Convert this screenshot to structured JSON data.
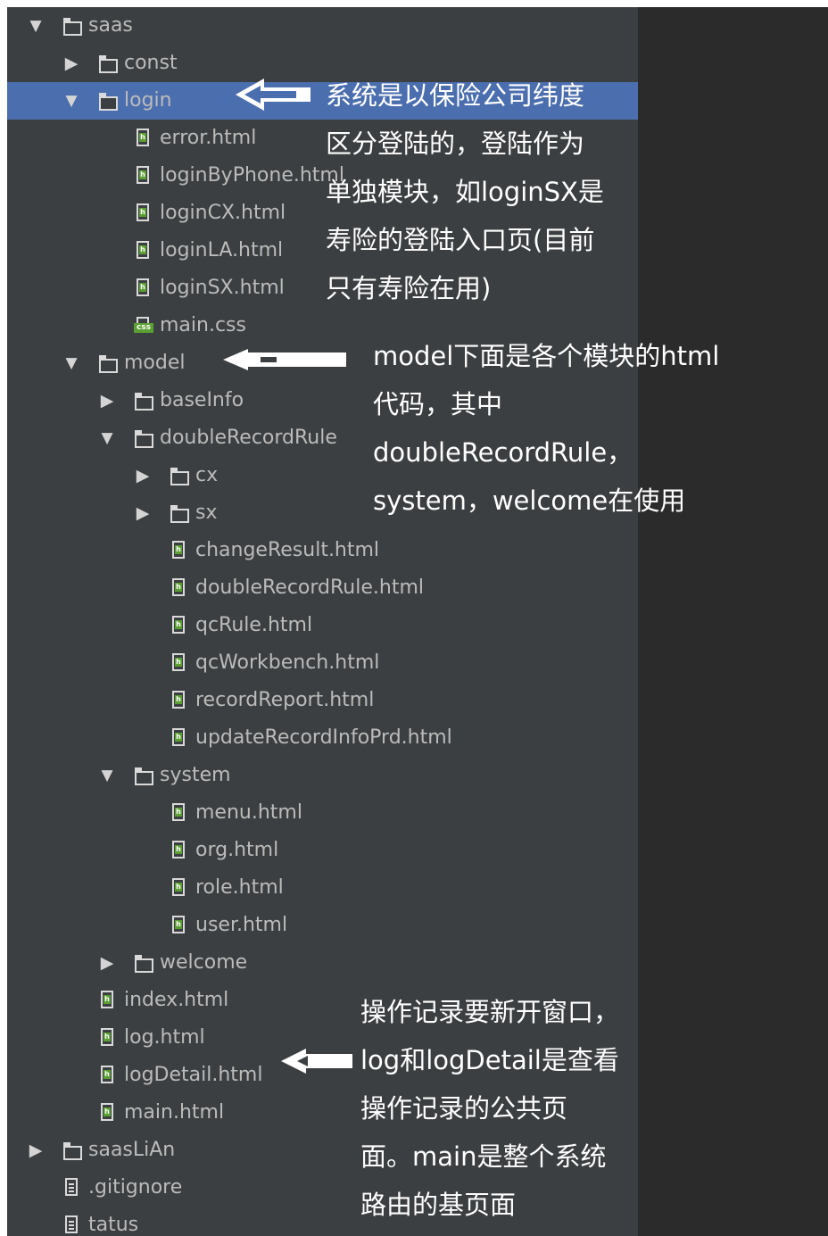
{
  "tree": [
    {
      "label": "saas",
      "type": "folder",
      "depth": 0,
      "arrow": "down"
    },
    {
      "label": "const",
      "type": "folder",
      "depth": 1,
      "arrow": "right"
    },
    {
      "label": "login",
      "type": "folder",
      "depth": 1,
      "arrow": "down",
      "selected": true
    },
    {
      "label": "error.html",
      "type": "html",
      "depth": 2
    },
    {
      "label": "loginByPhone.html",
      "type": "html",
      "depth": 2
    },
    {
      "label": "loginCX.html",
      "type": "html",
      "depth": 2
    },
    {
      "label": "loginLA.html",
      "type": "html",
      "depth": 2
    },
    {
      "label": "loginSX.html",
      "type": "html",
      "depth": 2
    },
    {
      "label": "main.css",
      "type": "css",
      "depth": 2
    },
    {
      "label": "model",
      "type": "folder",
      "depth": 1,
      "arrow": "down"
    },
    {
      "label": "baseInfo",
      "type": "folder",
      "depth": 2,
      "arrow": "right"
    },
    {
      "label": "doubleRecordRule",
      "type": "folder",
      "depth": 2,
      "arrow": "down"
    },
    {
      "label": "cx",
      "type": "folder",
      "depth": 3,
      "arrow": "right"
    },
    {
      "label": "sx",
      "type": "folder",
      "depth": 3,
      "arrow": "right"
    },
    {
      "label": "changeResult.html",
      "type": "html",
      "depth": 3
    },
    {
      "label": "doubleRecordRule.html",
      "type": "html",
      "depth": 3
    },
    {
      "label": "qcRule.html",
      "type": "html",
      "depth": 3
    },
    {
      "label": "qcWorkbench.html",
      "type": "html",
      "depth": 3
    },
    {
      "label": "recordReport.html",
      "type": "html",
      "depth": 3
    },
    {
      "label": "updateRecordInfoPrd.html",
      "type": "html",
      "depth": 3
    },
    {
      "label": "system",
      "type": "folder",
      "depth": 2,
      "arrow": "down"
    },
    {
      "label": "menu.html",
      "type": "html",
      "depth": 3
    },
    {
      "label": "org.html",
      "type": "html",
      "depth": 3
    },
    {
      "label": "role.html",
      "type": "html",
      "depth": 3
    },
    {
      "label": "user.html",
      "type": "html",
      "depth": 3
    },
    {
      "label": "welcome",
      "type": "folder",
      "depth": 2,
      "arrow": "right"
    },
    {
      "label": "index.html",
      "type": "html",
      "depth": 1
    },
    {
      "label": "log.html",
      "type": "html",
      "depth": 1
    },
    {
      "label": "logDetail.html",
      "type": "html",
      "depth": 1
    },
    {
      "label": "main.html",
      "type": "html",
      "depth": 1
    },
    {
      "label": "saasLiAn",
      "type": "folder",
      "depth": 0,
      "arrow": "right"
    },
    {
      "label": ".gitignore",
      "type": "text",
      "depth": 0
    },
    {
      "label": "tatus",
      "type": "text",
      "depth": 0
    }
  ],
  "notes": {
    "login": [
      "系统是以保险公司纬度",
      "区分登陆的，登陆作为",
      "单独模块，如loginSX是",
      "寿险的登陆入口页(目前",
      "只有寿险在用)"
    ],
    "model": [
      "model下面是各个模块的html",
      "代码，其中",
      "doubleRecordRule，",
      "system，welcome在使用"
    ],
    "log": [
      "操作记录要新开窗口，",
      "log和logDetail是查看",
      "操作记录的公共页",
      "面。main是整个系统",
      "路由的基页面"
    ]
  },
  "colors": {
    "panel": "#3c3f41",
    "selection": "#4b6eaf",
    "editor": "#2b2b2b",
    "text": "#bbbbbb",
    "html_badge": "#5a9f31"
  }
}
